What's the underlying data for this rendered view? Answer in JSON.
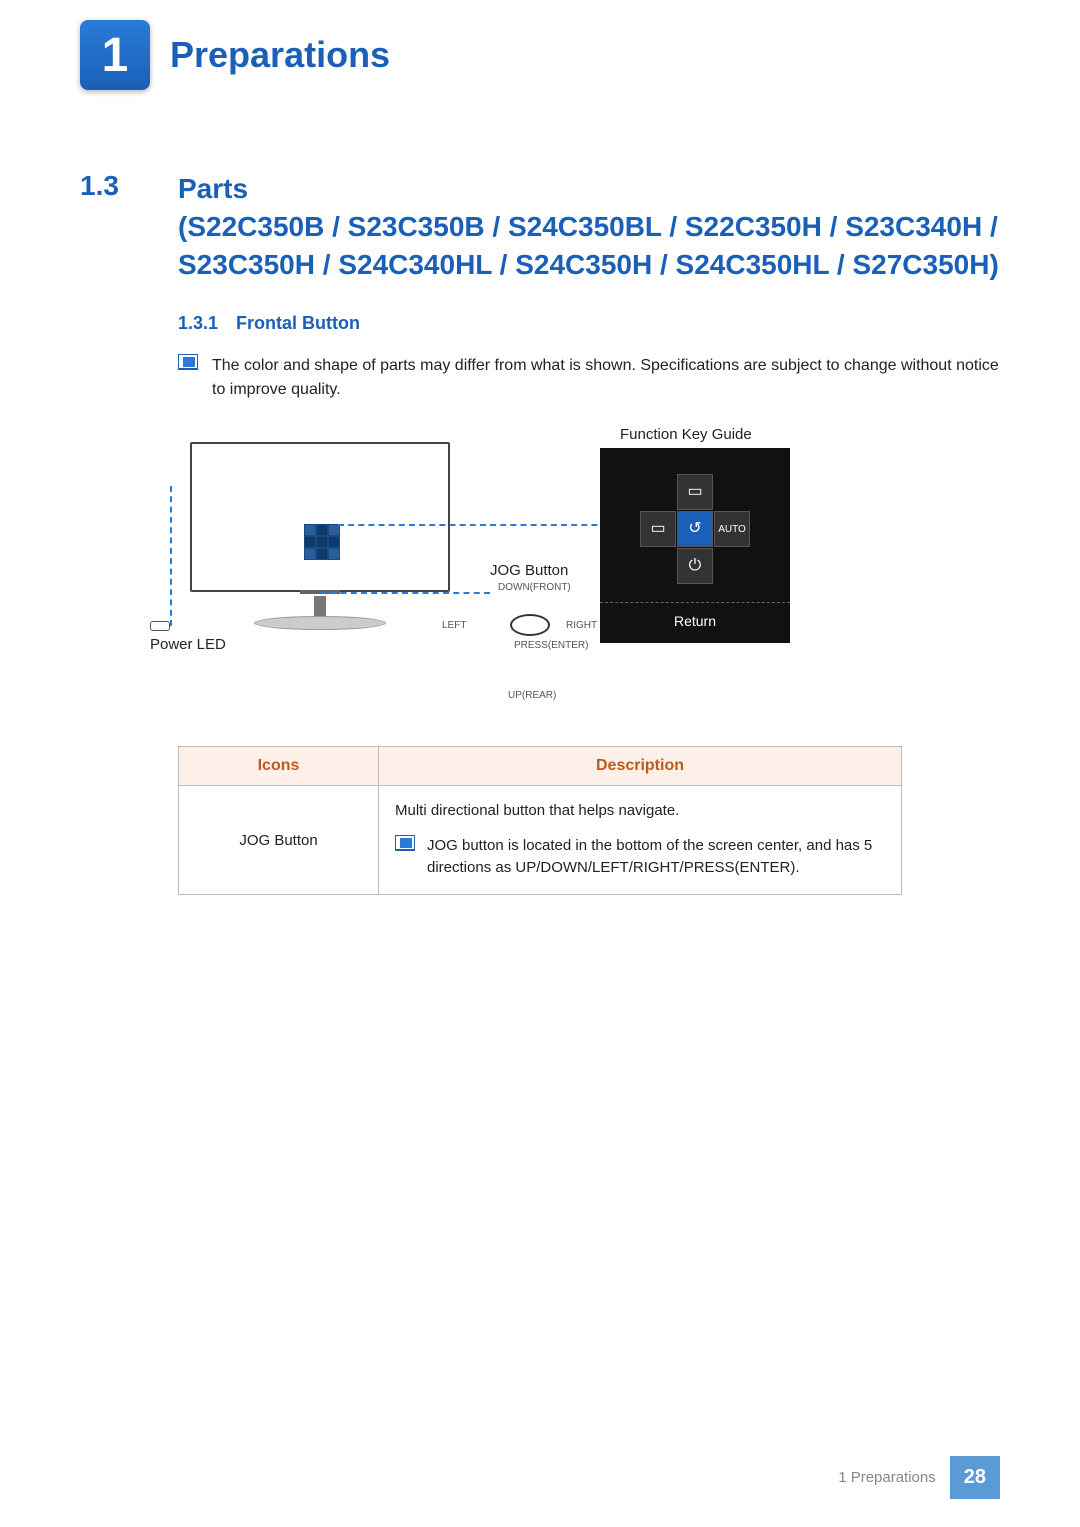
{
  "chapter": {
    "number": "1",
    "title": "Preparations"
  },
  "section": {
    "number": "1.3",
    "title": "Parts\n(S22C350B / S23C350B / S24C350BL / S22C350H / S23C340H / S23C350H / S24C340HL / S24C350H / S24C350HL / S27C350H)"
  },
  "subsection": {
    "number": "1.3.1",
    "title": "Frontal Button"
  },
  "note1": "The color and shape of parts may differ from what is shown. Specifications are subject to change without notice to improve quality.",
  "diagram": {
    "function_key_guide": "Function Key Guide",
    "return": "Return",
    "auto": "AUTO",
    "jog_button": "JOG Button",
    "power_led": "Power LED",
    "down_front": "DOWN(FRONT)",
    "left": "LEFT",
    "right": "RIGHT",
    "press_enter": "PRESS(ENTER)",
    "up_rear": "UP(REAR)"
  },
  "table": {
    "head_icons": "Icons",
    "head_desc": "Description",
    "row1_icon": "JOG Button",
    "row1_desc": "Multi directional button that helps navigate.",
    "row1_note": "JOG button is located in the bottom of the screen center, and has 5 directions as UP/DOWN/LEFT/RIGHT/PRESS(ENTER)."
  },
  "footer": {
    "crumb": "1 Preparations",
    "page": "28"
  }
}
